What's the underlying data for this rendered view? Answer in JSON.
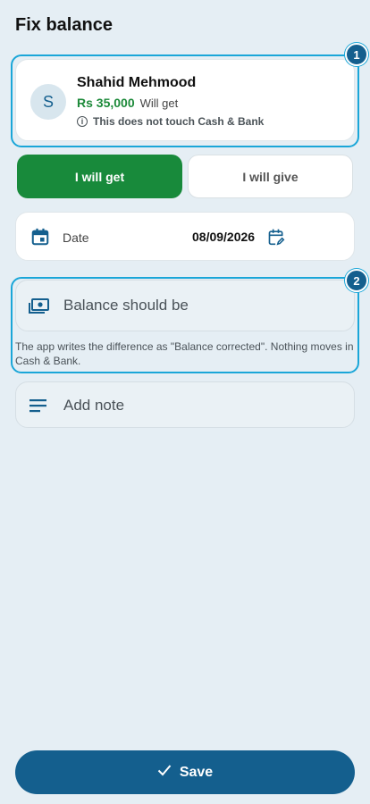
{
  "page": {
    "title": "Fix balance"
  },
  "highlights": {
    "badge1": "1",
    "badge2": "2"
  },
  "customer": {
    "initial": "S",
    "name": "Shahid Mehmood",
    "amount": "Rs 35,000",
    "amount_note": "Will get",
    "info_icon_glyph": "i",
    "info_text": "This does not touch Cash & Bank"
  },
  "toggle": {
    "get_label": "I will get",
    "give_label": "I will give",
    "selected": "get"
  },
  "date": {
    "label": "Date",
    "value": "08/09/2026"
  },
  "balance": {
    "placeholder": "Balance should be",
    "helper": "The app writes the difference as \"Balance corrected\". Nothing moves in Cash & Bank."
  },
  "note": {
    "placeholder": "Add note"
  },
  "save": {
    "label": "Save"
  },
  "colors": {
    "accent": "#145f8e",
    "positive": "#1d8a3a",
    "highlight": "#1aa6d8",
    "background": "#e5eef4"
  },
  "icons": {
    "date": "calendar-icon",
    "date_edit": "calendar-edit-icon",
    "balance": "cash-icon",
    "note": "notes-icon",
    "save": "check-icon",
    "info": "info-icon"
  }
}
